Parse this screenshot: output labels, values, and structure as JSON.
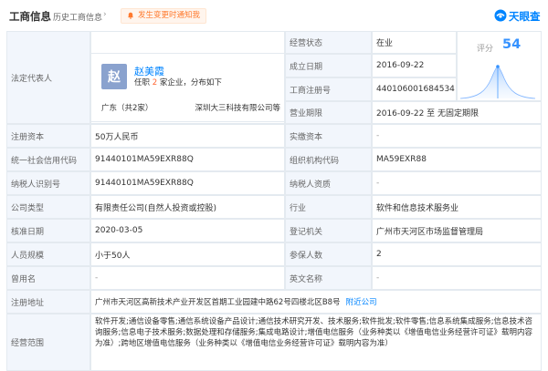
{
  "header": {
    "tab_active": "工商信息",
    "tab_history": "历史工商信息",
    "tab_history_arrow": "›",
    "notice": "发生变更时通知我",
    "logo_text": "天眼查"
  },
  "colors": {
    "accent": "#0084ff",
    "label_bg": "#f2f6fc",
    "border": "#e4eaf0",
    "notice_orange": "#ff7a2e"
  },
  "legal_rep": {
    "label": "法定代表人",
    "avatar_char": "赵",
    "name": "赵美霞",
    "info_prefix": "任职",
    "info_count": "2",
    "info_suffix": "家企业，分布如下",
    "region": "广东（共2家）",
    "company": "深圳大三科技有限公司等"
  },
  "score": {
    "label": "评分",
    "value": "54"
  },
  "rows": {
    "status_label": "经营状态",
    "status_value": "在业",
    "founded_label": "成立日期",
    "founded_value": "2016-09-22",
    "regno_label": "工商注册号",
    "regno_value": "440106001684534",
    "term_label": "营业期限",
    "term_value": "2016-09-22 至 无固定期限",
    "capital_label": "注册资本",
    "capital_value": "50万人民币",
    "paid_label": "实缴资本",
    "paid_value": "-",
    "credit_label": "统一社会信用代码",
    "credit_value": "91440101MA59EXR88Q",
    "org_label": "组织机构代码",
    "org_value": "MA59EXR88",
    "taxid_label": "纳税人识别号",
    "taxid_value": "91440101MA59EXR88Q",
    "taxq_label": "纳税人资质",
    "taxq_value": "-",
    "type_label": "公司类型",
    "type_value": "有限责任公司(自然人投资或控股)",
    "industry_label": "行业",
    "industry_value": "软件和信息技术服务业",
    "approve_label": "核准日期",
    "approve_value": "2020-03-05",
    "authority_label": "登记机关",
    "authority_value": "广州市天河区市场监督管理局",
    "staff_label": "人员规模",
    "staff_value": "小于50人",
    "insured_label": "参保人数",
    "insured_value": "2",
    "formername_label": "曾用名",
    "formername_value": "-",
    "english_label": "英文名称",
    "english_value": "-",
    "address_label": "注册地址",
    "address_value": "广州市天河区高新技术产业开发区首期工业园建中路62号四楼北区B8号",
    "address_link": "附近公司",
    "scope_label": "经营范围",
    "scope_value": "软件开发;通信设备零售;通信系统设备产品设计;通信技术研究开发、技术服务;软件批发;软件零售;信息系统集成服务;信息技术咨询服务;信息电子技术服务;数据处理和存储服务;集成电路设计;增值电信服务（业务种类以《增值电信业务经营许可证》载明内容为准）;跨地区增值电信服务（业务种类以《增值电信业务经营许可证》载明内容为准）"
  }
}
